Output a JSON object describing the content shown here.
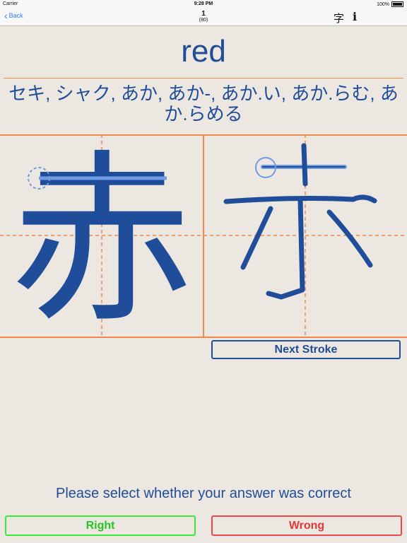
{
  "status_bar": {
    "carrier": "Carrier",
    "time": "9:28 PM",
    "battery": "100%"
  },
  "nav": {
    "back_label": "Back",
    "count": "1",
    "total": "(80)",
    "kanji_label": "字",
    "info_label": "i"
  },
  "card": {
    "meaning": "red",
    "readings": "セキ, シャク, あか, あか-, あか.い, あか.らむ, あか.らめる",
    "reference_kanji": "赤"
  },
  "actions": {
    "next_stroke": "Next Stroke",
    "prompt": "Please select whether your answer was correct",
    "right": "Right",
    "wrong": "Wrong"
  },
  "colors": {
    "ink": "#1f4d9a",
    "guide": "#f08a4b",
    "ios_blue": "#2f7cf6",
    "right": "#3ee83a",
    "wrong": "#e84a4a"
  }
}
